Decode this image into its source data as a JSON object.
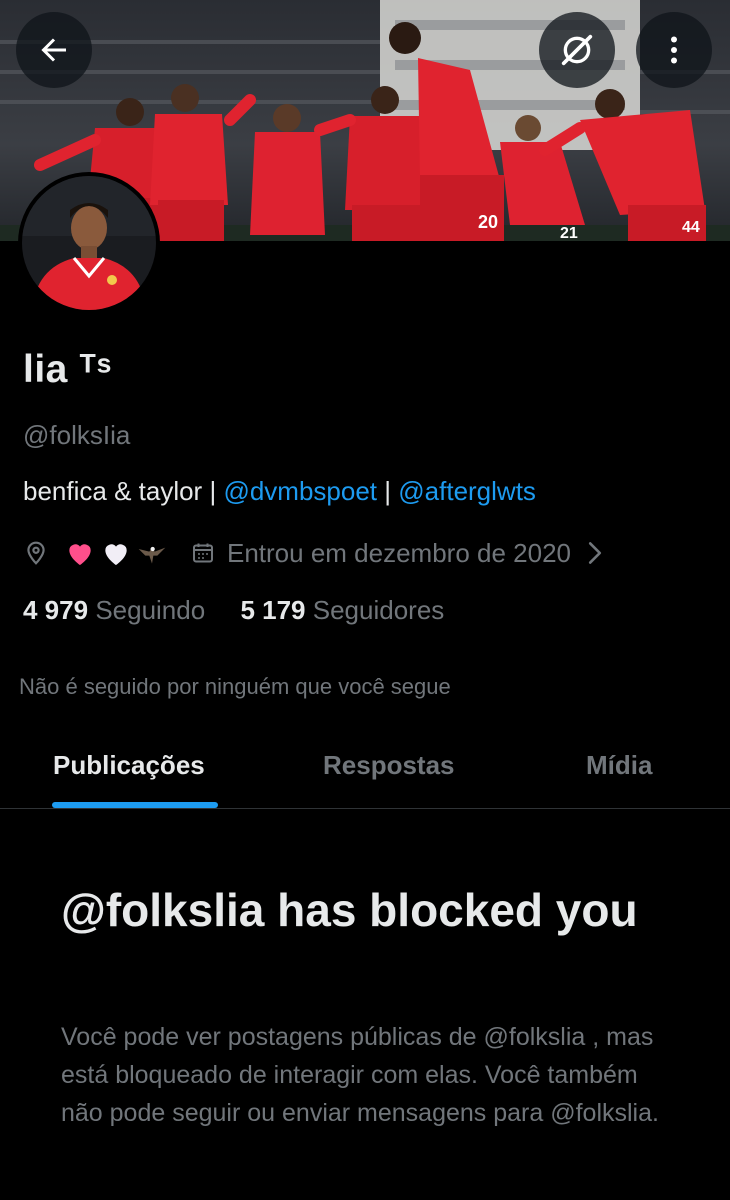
{
  "header": {
    "back_icon": "arrow-left-icon",
    "grok_icon": "grok-icon",
    "more_icon": "more-vertical-icon"
  },
  "profile": {
    "display_name": "lia ᵀˢ",
    "handle": "@folksIia",
    "bio_text": "benfica & taylor",
    "bio_sep": "|",
    "bio_link_1": "@dvmbspoet",
    "bio_link_2": "@afterglwts",
    "location_icon": "location-pin-icon",
    "location_emojis": [
      "pink-heart-icon",
      "white-heart-icon",
      "eagle-icon"
    ],
    "calendar_icon": "calendar-icon",
    "joined": "Entrou em dezembro de 2020",
    "following_count": "4 979",
    "following_label": "Seguindo",
    "followers_count": "5 179",
    "followers_label": "Seguidores",
    "not_followed": "Não é seguido por ninguém que você segue"
  },
  "tabs": [
    {
      "label": "Publicações",
      "active": true
    },
    {
      "label": "Respostas",
      "active": false
    },
    {
      "label": "Mídia",
      "active": false
    }
  ],
  "blocked": {
    "title": "@folkslia has blocked you",
    "body": "Você pode ver postagens públicas de @folkslia , mas está bloqueado de interagir com elas. Você também não pode seguir ou enviar mensagens para @folkslia."
  },
  "colors": {
    "accent": "#1d9bf0",
    "background": "#000000",
    "text_primary": "#e7e9ea",
    "text_secondary": "#71767b"
  }
}
